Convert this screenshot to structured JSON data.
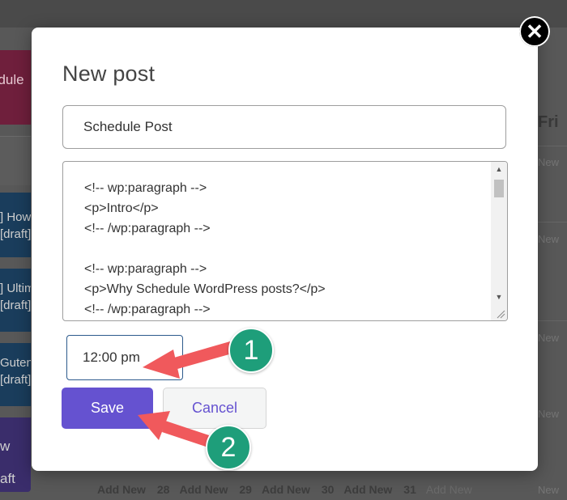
{
  "background": {
    "event_fragments": [
      [
        "edule"
      ],
      [
        "] How",
        "[draft]"
      ],
      [
        "] Ultim",
        "[draft]"
      ],
      [
        "Gutenb",
        "[draft]"
      ],
      [
        "w",
        "aft"
      ]
    ],
    "day_header": "Fri",
    "right_add_new": [
      "New",
      "New",
      "New",
      "New",
      "New"
    ],
    "bottom_row": [
      {
        "kind": "add",
        "text": "Add New"
      },
      {
        "kind": "num",
        "text": "28"
      },
      {
        "kind": "add",
        "text": "Add New"
      },
      {
        "kind": "num",
        "text": "29"
      },
      {
        "kind": "add",
        "text": "Add New"
      },
      {
        "kind": "num",
        "text": "30"
      },
      {
        "kind": "add",
        "text": "Add New"
      },
      {
        "kind": "num",
        "text": "31"
      },
      {
        "kind": "last",
        "text": "Add New"
      }
    ]
  },
  "modal": {
    "title": "New post",
    "close_glyph": "✕",
    "post_title_value": "Schedule Post",
    "content_value": "<!-- wp:paragraph -->\n<p>Intro</p>\n<!-- /wp:paragraph -->\n\n<!-- wp:paragraph -->\n<p>Why Schedule WordPress posts?</p>\n<!-- /wp:paragraph -->",
    "time_value": "12:00 pm",
    "save_label": "Save",
    "cancel_label": "Cancel"
  },
  "annotations": {
    "badge_1": "1",
    "badge_2": "2",
    "arrow_color": "#f0595c",
    "badge_color": "#1e9e7a"
  },
  "colors": {
    "accent": "#6552d0",
    "overlay": "#585858"
  }
}
